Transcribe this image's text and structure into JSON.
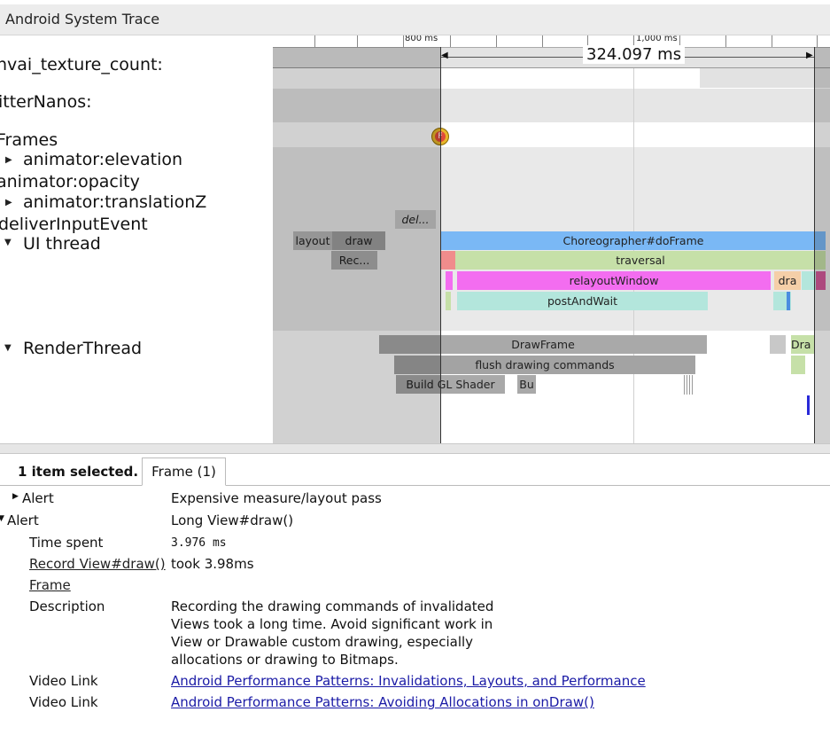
{
  "window": {
    "title": "Android System Trace"
  },
  "tracks": {
    "names": [
      {
        "label": "nvai_texture_count:"
      },
      {
        "label": "itterNanos:"
      },
      {
        "label": "Frames"
      },
      {
        "label": "animator:elevation"
      },
      {
        "label": "animator:opacity"
      },
      {
        "label": "animator:translationZ"
      },
      {
        "label": "deliverInputEvent"
      },
      {
        "label": "UI thread"
      },
      {
        "label": "RenderThread"
      }
    ]
  },
  "timeline": {
    "ruler": {
      "label_800": "800 ms",
      "label_1000": "1,000 ms"
    },
    "measurement": "324.097 ms",
    "frame_marker": "F",
    "slices": {
      "deliver": "del...",
      "layout": "layout",
      "draw": "draw",
      "rec": "Rec...",
      "choreographer": "Choreographer#doFrame",
      "traversal": "traversal",
      "relayout": "relayoutWindow",
      "dra": "dra",
      "postandwait": "postAndWait",
      "drawframe": "DrawFrame",
      "dra2": "Dra",
      "flush": "flush drawing commands",
      "buildgl": "Build GL Shader",
      "bu": "Bu"
    },
    "colors": {
      "choreographer": "#7ab8f5",
      "traversal": "#c6e0a8",
      "relayout": "#f36df0",
      "postandwait": "#b3e6dc",
      "renderthread_gray": "#a9a9a9",
      "dra": "#f5cfa8"
    }
  },
  "selection": {
    "text": "1 item selected.",
    "tab_label": "Frame (1)"
  },
  "details": {
    "alert1": {
      "key": "Alert",
      "value": "Expensive measure/layout pass"
    },
    "alert2": {
      "key": "Alert",
      "value": "Long View#draw()"
    },
    "time_spent": {
      "key": "Time spent",
      "value": "3.976 ms"
    },
    "record": {
      "key": "Record View#draw()",
      "value": "took 3.98ms"
    },
    "frame": {
      "key": "Frame"
    },
    "description": {
      "key": "Description",
      "line1": "Recording the drawing commands of invalidated",
      "line2": "Views took a long time. Avoid significant work in",
      "line3": "View or Drawable custom drawing, especially",
      "line4": "allocations or drawing to Bitmaps."
    },
    "video1": {
      "key": "Video Link",
      "value": "Android Performance Patterns: Invalidations, Layouts, and Performance"
    },
    "video2": {
      "key": "Video Link",
      "value": "Android Performance Patterns: Avoiding Allocations in onDraw()"
    }
  }
}
